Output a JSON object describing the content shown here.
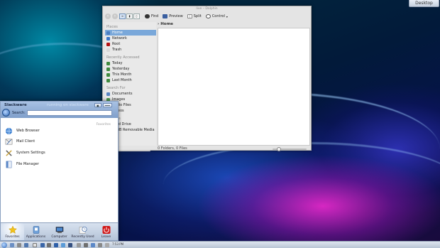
{
  "desktop": {
    "button_label": "Desktop"
  },
  "dolphin": {
    "title": "live – Dolphin",
    "toolbar": {
      "find": "Find",
      "preview": "Preview",
      "split": "Split",
      "control": "Control"
    },
    "view_modes": [
      "≡",
      "▮",
      "▯"
    ],
    "places_sections": [
      {
        "header": "Places",
        "items": [
          {
            "label": "Home",
            "selected": true,
            "icon_color": "#4a7fc4"
          },
          {
            "label": "Network",
            "icon_color": "#3b76c8"
          },
          {
            "label": "Root",
            "icon_color": "#b31212"
          },
          {
            "label": "Trash",
            "icon_color": "#d8d8d8"
          }
        ]
      },
      {
        "header": "Recently Accessed",
        "items": [
          {
            "label": "Today",
            "icon_color": "#3f8a3f"
          },
          {
            "label": "Yesterday",
            "icon_color": "#3f8a3f"
          },
          {
            "label": "This Month",
            "icon_color": "#3f8a3f"
          },
          {
            "label": "Last Month",
            "icon_color": "#3f8a3f"
          }
        ]
      },
      {
        "header": "Search For",
        "items": [
          {
            "label": "Documents",
            "icon_color": "#5a86c2"
          },
          {
            "label": "Images",
            "icon_color": "#4f9c4f"
          },
          {
            "label": "Audio Files",
            "icon_color": "#8c6fb0"
          },
          {
            "label": "Videos",
            "icon_color": "#c27a2e"
          }
        ]
      },
      {
        "header": "Devices",
        "items": [
          {
            "label": "Hard Drive",
            "icon_color": "#8a8a8a"
          },
          {
            "label": "4 GiB Removable Media",
            "icon_color": "#8a8a8a"
          }
        ]
      }
    ],
    "breadcrumb": "Home",
    "status_text": "0 Folders, 0 Files",
    "zoom_fraction": 0.18
  },
  "kickoff": {
    "user": "Slackware",
    "host": "running on slackware",
    "search_label": "Search:",
    "search_value": "",
    "favorites_header": "Favorites",
    "favorites": [
      {
        "name": "Web Browser",
        "icon": "globe-icon"
      },
      {
        "name": "Mail Client",
        "icon": "mail-icon"
      },
      {
        "name": "System Settings",
        "icon": "settings-icon"
      },
      {
        "name": "File Manager",
        "icon": "folder-icon"
      }
    ],
    "tabs": [
      {
        "label": "Favorites",
        "icon": "star-icon",
        "active": true
      },
      {
        "label": "Applications",
        "icon": "applications-icon"
      },
      {
        "label": "Computer",
        "icon": "computer-icon"
      },
      {
        "label": "Recently Used",
        "icon": "clock-icon"
      },
      {
        "label": "Leave",
        "icon": "power-icon"
      }
    ]
  },
  "taskbar": {
    "clock": "7:53 PM"
  }
}
